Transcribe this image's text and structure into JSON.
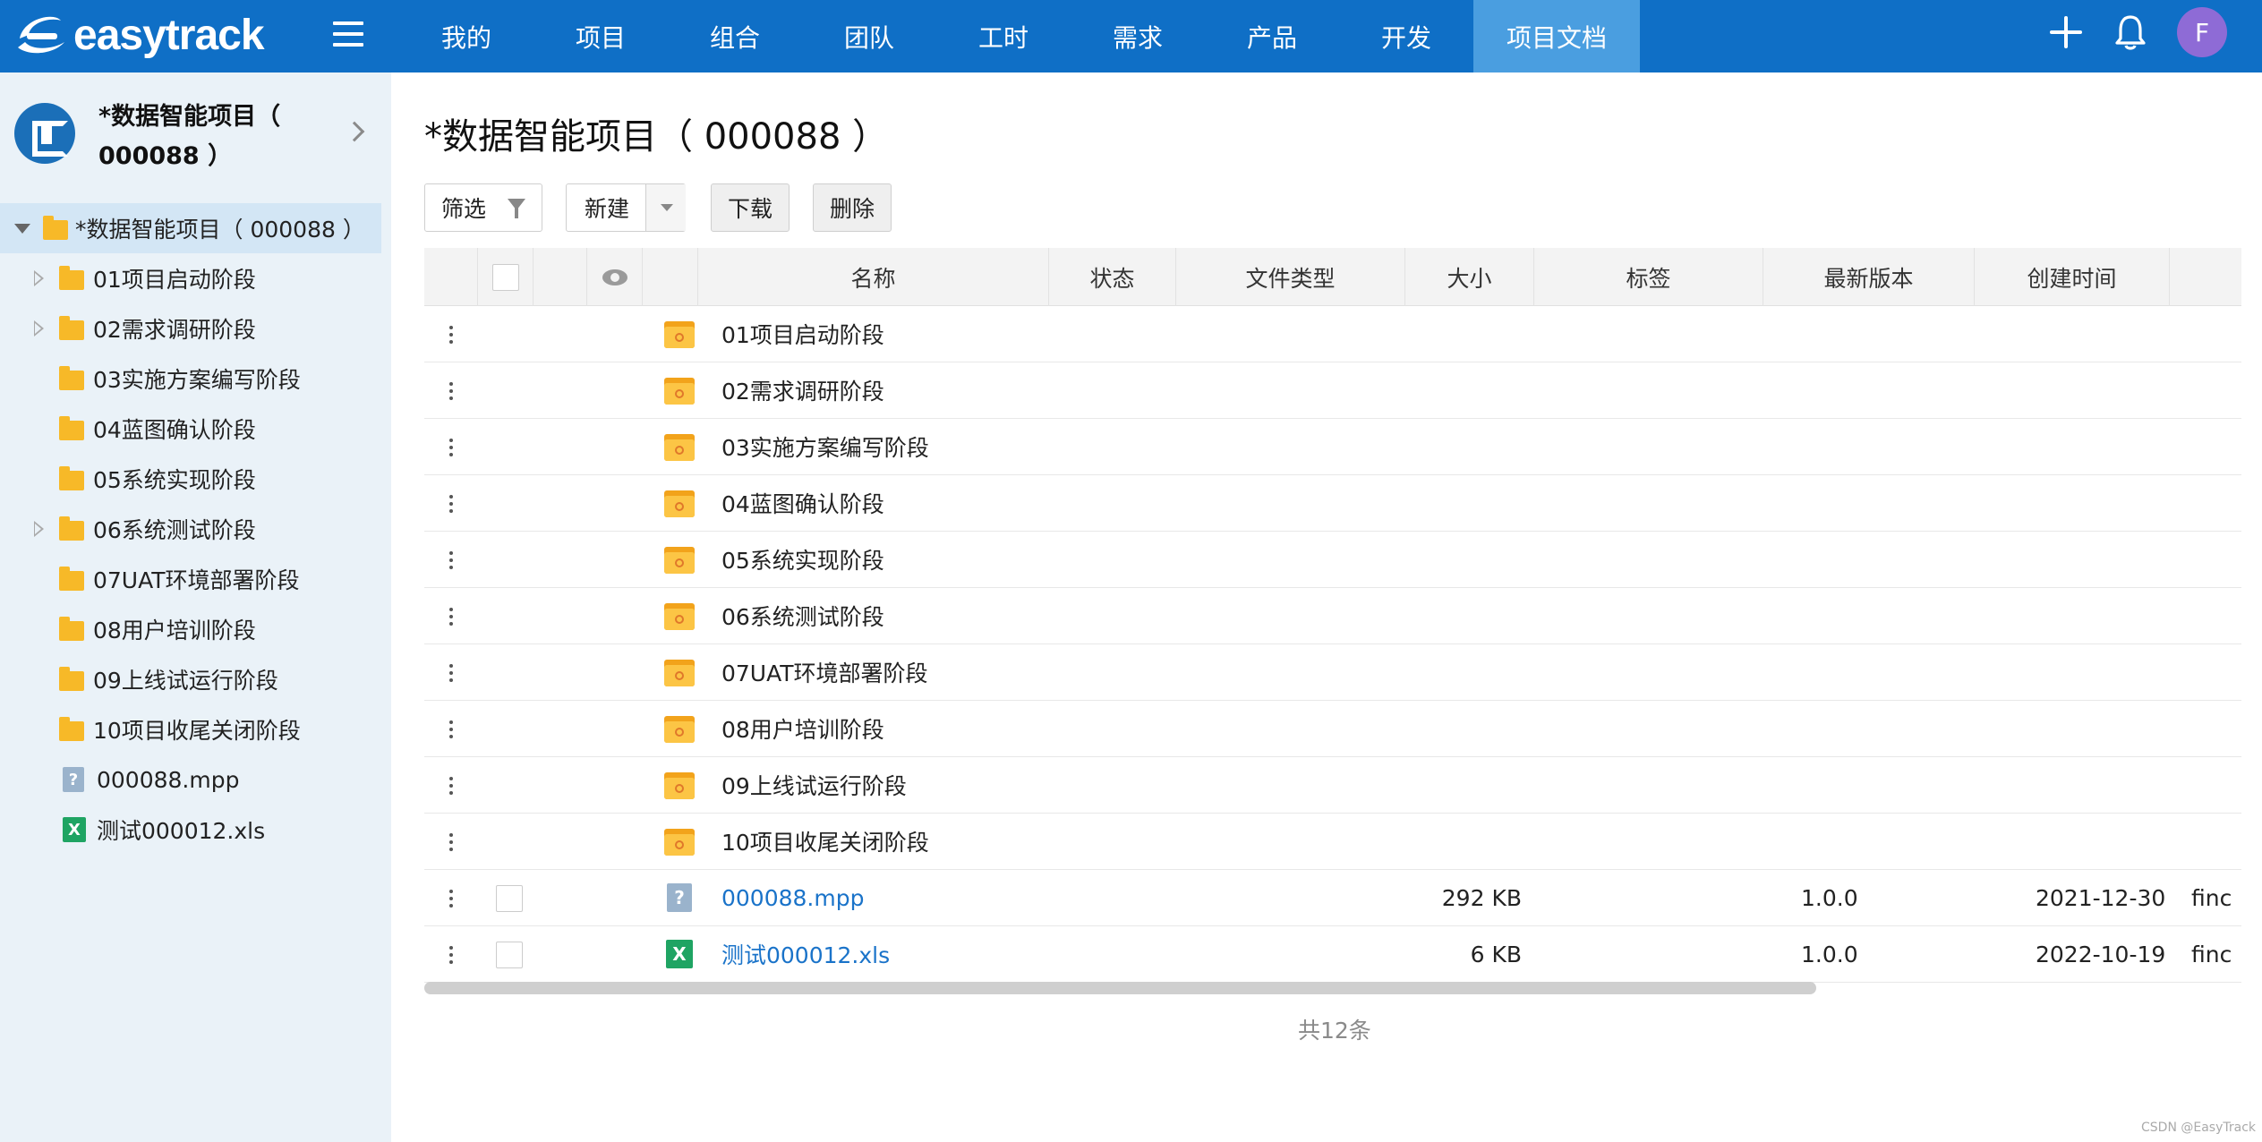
{
  "brand": {
    "logo_text": "easytrack"
  },
  "nav": {
    "items": [
      "我的",
      "项目",
      "组合",
      "团队",
      "工时",
      "需求",
      "产品",
      "开发",
      "项目文档"
    ],
    "active_index": 8
  },
  "topbar": {
    "plus_icon": "plus-icon",
    "bell_icon": "bell-icon",
    "avatar_letter": "F"
  },
  "sidebar": {
    "project_title": "*数据智能项目（ 000088 ）",
    "tree": [
      {
        "label": "*数据智能项目（ 000088 ）",
        "type": "folder",
        "level": 0,
        "expanded": true,
        "selected": true
      },
      {
        "label": "01项目启动阶段",
        "type": "folder",
        "level": 1,
        "has_children": true
      },
      {
        "label": "02需求调研阶段",
        "type": "folder",
        "level": 1,
        "has_children": true
      },
      {
        "label": "03实施方案编写阶段",
        "type": "folder",
        "level": 1,
        "has_children": false
      },
      {
        "label": "04蓝图确认阶段",
        "type": "folder",
        "level": 1,
        "has_children": false
      },
      {
        "label": "05系统实现阶段",
        "type": "folder",
        "level": 1,
        "has_children": false
      },
      {
        "label": "06系统测试阶段",
        "type": "folder",
        "level": 1,
        "has_children": true
      },
      {
        "label": "07UAT环境部署阶段",
        "type": "folder",
        "level": 1,
        "has_children": false
      },
      {
        "label": "08用户培训阶段",
        "type": "folder",
        "level": 1,
        "has_children": false
      },
      {
        "label": "09上线试运行阶段",
        "type": "folder",
        "level": 1,
        "has_children": false
      },
      {
        "label": "10项目收尾关闭阶段",
        "type": "folder",
        "level": 1,
        "has_children": false
      },
      {
        "label": "000088.mpp",
        "type": "file-unknown",
        "level": 1,
        "icon_glyph": "?"
      },
      {
        "label": "测试000012.xls",
        "type": "file-excel",
        "level": 1,
        "icon_glyph": "X"
      }
    ]
  },
  "main": {
    "title": "*数据智能项目（ 000088 ）",
    "toolbar": {
      "filter": "筛选",
      "new": "新建",
      "download": "下载",
      "delete": "删除"
    },
    "table": {
      "headers": {
        "name": "名称",
        "status": "状态",
        "file_type": "文件类型",
        "size": "大小",
        "tags": "标签",
        "latest_version": "最新版本",
        "created_time": "创建时间"
      },
      "rows": [
        {
          "name": "01项目启动阶段",
          "type": "folder"
        },
        {
          "name": "02需求调研阶段",
          "type": "folder"
        },
        {
          "name": "03实施方案编写阶段",
          "type": "folder"
        },
        {
          "name": "04蓝图确认阶段",
          "type": "folder"
        },
        {
          "name": "05系统实现阶段",
          "type": "folder"
        },
        {
          "name": "06系统测试阶段",
          "type": "folder"
        },
        {
          "name": "07UAT环境部署阶段",
          "type": "folder"
        },
        {
          "name": "08用户培训阶段",
          "type": "folder"
        },
        {
          "name": "09上线试运行阶段",
          "type": "folder"
        },
        {
          "name": "10项目收尾关闭阶段",
          "type": "folder"
        },
        {
          "name": "000088.mpp",
          "type": "file-unknown",
          "icon_glyph": "?",
          "size": "292 KB",
          "version": "1.0.0",
          "created": "2021-12-30",
          "creator": "finc"
        },
        {
          "name": "测试000012.xls",
          "type": "file-excel",
          "icon_glyph": "X",
          "size": "6 KB",
          "version": "1.0.0",
          "created": "2022-10-19",
          "creator": "finc"
        }
      ]
    },
    "total": "共12条"
  },
  "watermark": "CSDN @EasyTrack",
  "colors": {
    "topbar": "#0f6fc6",
    "nav_active": "#4a9ee0",
    "sidebar_bg": "#eaf2f8",
    "tree_selected": "#d3e6f5",
    "link": "#1a73c9",
    "folder": "#f7b928",
    "excel": "#1fa463",
    "avatar": "#8e6bd6"
  }
}
